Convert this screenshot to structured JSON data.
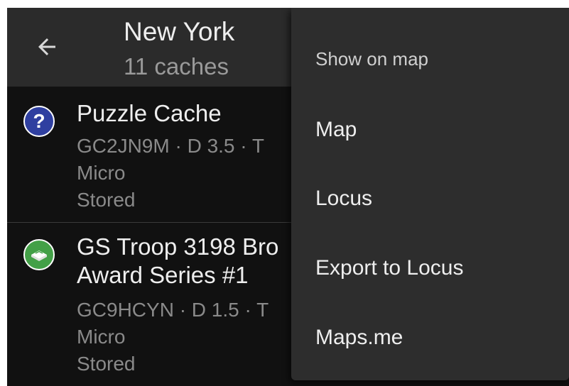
{
  "toolbar": {
    "title": "New York",
    "subtitle": "11 caches",
    "back_icon": "arrow-back-icon"
  },
  "caches": [
    {
      "title": "Puzzle Cache",
      "code_line": "GC2JN9M · D 3.5 · T",
      "size": "Micro",
      "status": "Stored",
      "icon": "question-mark-icon",
      "icon_glyph": "?",
      "icon_color": "#2f3fa0"
    },
    {
      "title_line1": "GS Troop 3198 Bro",
      "title_line2": "Award Series #1",
      "code_line": "GC9HCYN · D 1.5 · T",
      "size": "Micro",
      "status": "Stored",
      "icon": "traditional-cache-icon",
      "icon_color": "#43a047"
    }
  ],
  "menu": {
    "header": "Show on map",
    "items": [
      {
        "label": "Map"
      },
      {
        "label": "Locus"
      },
      {
        "label": "Export to Locus"
      },
      {
        "label": "Maps.me"
      }
    ]
  },
  "colors": {
    "toolbar_bg": "#2b2b2b",
    "list_bg": "#111111",
    "menu_bg": "#2d2d2d",
    "primary_text": "#eeeeee",
    "secondary_text": "#8a8a8a"
  }
}
